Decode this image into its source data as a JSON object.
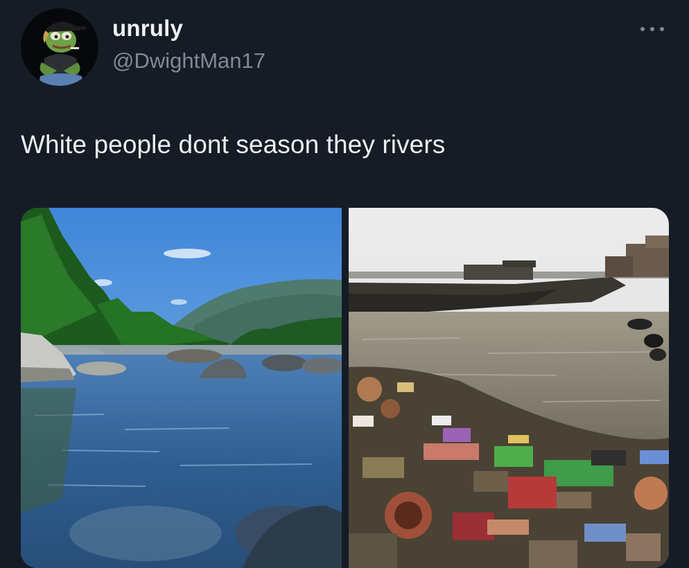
{
  "tweet": {
    "author": {
      "display_name": "unruly",
      "handle": "@DwightMan17",
      "avatar_icon": "frog-avatar-icon"
    },
    "more_icon": "more-options-icon",
    "text": "White people dont season they rivers",
    "media": [
      {
        "icon": "clean-river-photo"
      },
      {
        "icon": "polluted-river-photo"
      }
    ]
  },
  "colors": {
    "background": "#161c26",
    "primary_text": "#eef1f4",
    "secondary_text": "#7f8a97"
  }
}
